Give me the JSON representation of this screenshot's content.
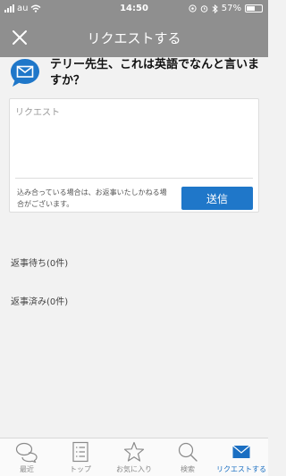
{
  "status_bar": {
    "carrier": "au",
    "time": "14:50",
    "battery": "57%",
    "battery_level": 0.57
  },
  "nav": {
    "title": "リクエストする"
  },
  "question": {
    "text": "テリー先生、これは英語でなんと言いますか？"
  },
  "request": {
    "placeholder": "リクエスト",
    "notice": "込み合っている場合は、お返事いたしかねる場合がございます。",
    "send_label": "送信"
  },
  "sections": {
    "pending": "返事待ち(0件)",
    "replied": "返事済み(0件)"
  },
  "tabs": [
    {
      "label": "最近",
      "icon": "chat-bubbles-icon"
    },
    {
      "label": "トップ",
      "icon": "list-icon"
    },
    {
      "label": "お気に入り",
      "icon": "star-icon"
    },
    {
      "label": "検索",
      "icon": "search-icon"
    },
    {
      "label": "リクエストする",
      "icon": "envelope-icon",
      "active": true
    }
  ],
  "colors": {
    "header": "#8f8f8f",
    "accent": "#1f77c9",
    "active_tab": "#1b6fc2",
    "inactive_tab": "#8a8a8a"
  }
}
